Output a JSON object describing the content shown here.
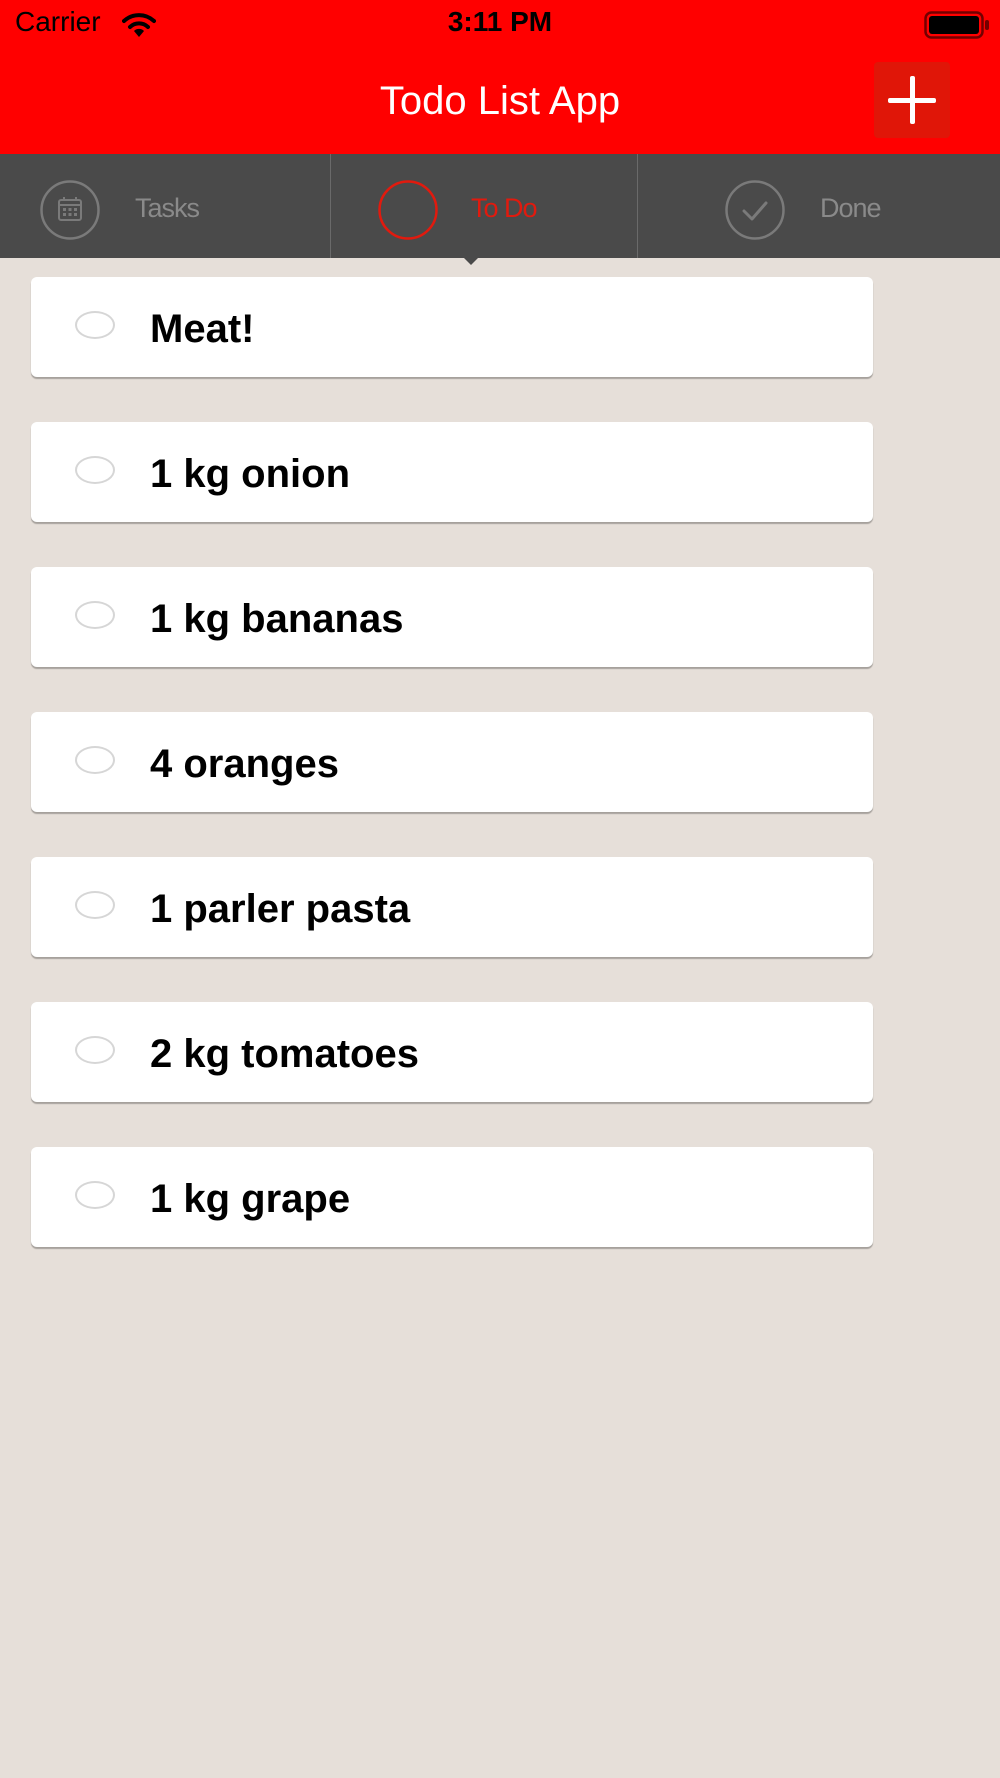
{
  "status_bar": {
    "carrier": "Carrier",
    "time": "3:11 PM"
  },
  "header": {
    "title": "Todo List App",
    "add_icon": "plus-icon"
  },
  "tabs": [
    {
      "label": "Tasks",
      "icon": "calendar-icon",
      "active": false
    },
    {
      "label": "To Do",
      "icon": "circle-icon",
      "active": true
    },
    {
      "label": "Done",
      "icon": "checkmark-icon",
      "active": false
    }
  ],
  "todos": [
    {
      "text": "Meat!",
      "done": false
    },
    {
      "text": "1 kg onion",
      "done": false
    },
    {
      "text": "1 kg bananas",
      "done": false
    },
    {
      "text": "4 oranges",
      "done": false
    },
    {
      "text": "1 parler pasta",
      "done": false
    },
    {
      "text": "2 kg tomatoes",
      "done": false
    },
    {
      "text": "1 kg grape",
      "done": false
    }
  ],
  "colors": {
    "header_bg": "#ff0000",
    "tabbar_bg": "#4a4a4a",
    "active_tab": "#e11a0e",
    "inactive_tab": "#8a8a8a",
    "page_bg": "#e6dfd9"
  }
}
